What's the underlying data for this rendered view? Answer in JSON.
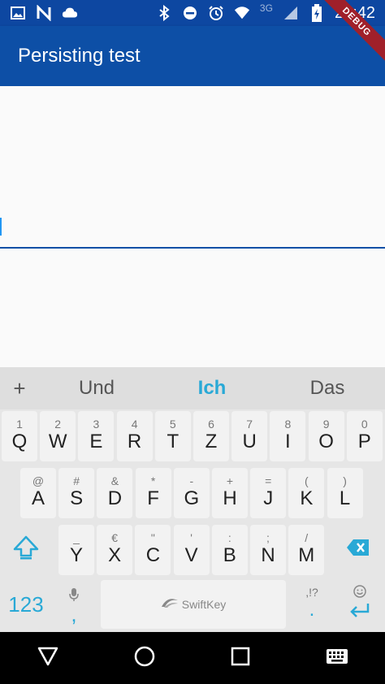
{
  "status_bar": {
    "time": "21:42",
    "network": "3G"
  },
  "app_bar": {
    "title": "Persisting test"
  },
  "debug_banner": {
    "label": "DEBUG"
  },
  "text_field": {
    "value": ""
  },
  "keyboard": {
    "suggestions": [
      "Und",
      "Ich",
      "Das"
    ],
    "suggestion_plus": "+",
    "row1": [
      {
        "main": "Q",
        "sub": "1"
      },
      {
        "main": "W",
        "sub": "2"
      },
      {
        "main": "E",
        "sub": "3"
      },
      {
        "main": "R",
        "sub": "4"
      },
      {
        "main": "T",
        "sub": "5"
      },
      {
        "main": "Z",
        "sub": "6"
      },
      {
        "main": "U",
        "sub": "7"
      },
      {
        "main": "I",
        "sub": "8"
      },
      {
        "main": "O",
        "sub": "9"
      },
      {
        "main": "P",
        "sub": "0"
      }
    ],
    "row2": [
      {
        "main": "A",
        "sub": "@"
      },
      {
        "main": "S",
        "sub": "#"
      },
      {
        "main": "D",
        "sub": "&"
      },
      {
        "main": "F",
        "sub": "*"
      },
      {
        "main": "G",
        "sub": "-"
      },
      {
        "main": "H",
        "sub": "+"
      },
      {
        "main": "J",
        "sub": "="
      },
      {
        "main": "K",
        "sub": "("
      },
      {
        "main": "L",
        "sub": ")"
      }
    ],
    "row3": [
      {
        "main": "Y",
        "sub": "_"
      },
      {
        "main": "X",
        "sub": "€"
      },
      {
        "main": "C",
        "sub": "\""
      },
      {
        "main": "V",
        "sub": "'"
      },
      {
        "main": "B",
        "sub": ":"
      },
      {
        "main": "N",
        "sub": ";"
      },
      {
        "main": "M",
        "sub": "/"
      }
    ],
    "numbers_label": "123",
    "comma_label": ",",
    "space_label": "SwiftKey",
    "period_label": ".",
    "period_sub": ",!?",
    "colors": {
      "accent": "#29a9d6",
      "key_bg": "#f2f2f2",
      "keyboard_bg": "#e6e6e6"
    }
  },
  "colors": {
    "primary": "#0d4fa6",
    "primary_dark": "#0d47a1",
    "debug": "#a0202a"
  }
}
